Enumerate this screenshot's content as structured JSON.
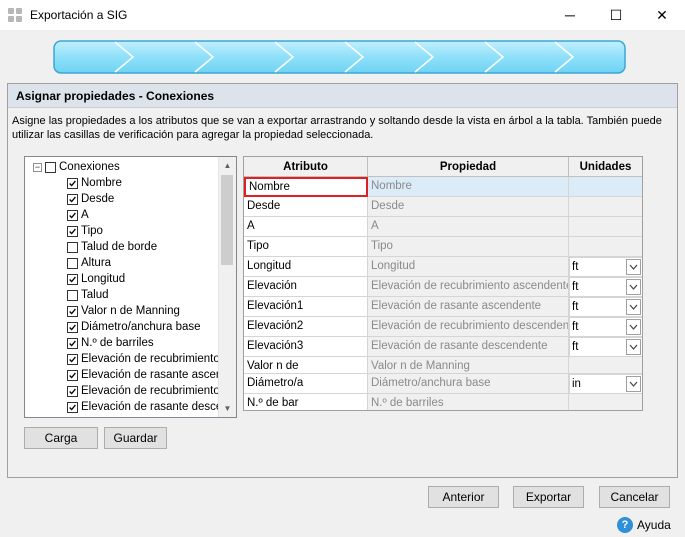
{
  "window": {
    "title": "Exportación a SIG",
    "minimize": "─",
    "maximize": "☐",
    "close": "✕"
  },
  "section": {
    "title": "Asignar propiedades - Conexiones",
    "description": "Asigne las propiedades a los atributos que se van a exportar arrastrando y soltando desde la vista en árbol a la tabla. También puede utilizar las casillas de verificación para agregar la propiedad seleccionada."
  },
  "tree": {
    "root": {
      "label": "Conexiones",
      "checked": false,
      "expander": "−"
    },
    "items": [
      {
        "label": "Nombre",
        "checked": true
      },
      {
        "label": "Desde",
        "checked": true
      },
      {
        "label": "A",
        "checked": true
      },
      {
        "label": "Tipo",
        "checked": true
      },
      {
        "label": "Talud de borde",
        "checked": false
      },
      {
        "label": "Altura",
        "checked": false
      },
      {
        "label": "Longitud",
        "checked": true
      },
      {
        "label": "Talud",
        "checked": false
      },
      {
        "label": "Valor n de Manning",
        "checked": true
      },
      {
        "label": "Diámetro/anchura base",
        "checked": true
      },
      {
        "label": "N.º de barriles",
        "checked": true
      },
      {
        "label": "Elevación de recubrimiento ascendente",
        "checked": true
      },
      {
        "label": "Elevación de rasante ascendente",
        "checked": true
      },
      {
        "label": "Elevación de recubrimiento descendente",
        "checked": true
      },
      {
        "label": "Elevación de rasante descendente",
        "checked": true
      }
    ]
  },
  "buttons": {
    "load": "Carga",
    "save": "Guardar",
    "prev": "Anterior",
    "export": "Exportar",
    "cancel": "Cancelar",
    "help": "Ayuda"
  },
  "table": {
    "headers": {
      "attribute": "Atributo",
      "property": "Propiedad",
      "units": "Unidades"
    },
    "rows": [
      {
        "attribute": "Nombre",
        "property": "Nombre",
        "units": ""
      },
      {
        "attribute": "Desde",
        "property": "Desde",
        "units": ""
      },
      {
        "attribute": "A",
        "property": "A",
        "units": ""
      },
      {
        "attribute": "Tipo",
        "property": "Tipo",
        "units": ""
      },
      {
        "attribute": "Longitud",
        "property": "Longitud",
        "units": "ft"
      },
      {
        "attribute": "Elevación",
        "property": "Elevación de recubrimiento ascendente",
        "units": "ft"
      },
      {
        "attribute": "Elevación1",
        "property": "Elevación de rasante ascendente",
        "units": "ft"
      },
      {
        "attribute": "Elevación2",
        "property": "Elevación de recubrimiento descendente",
        "units": "ft"
      },
      {
        "attribute": "Elevación3",
        "property": "Elevación de rasante descendente",
        "units": "ft"
      },
      {
        "attribute": "Valor n de",
        "property": "Valor n de Manning",
        "units": ""
      },
      {
        "attribute": "Diámetro/a",
        "property": "Diámetro/anchura base",
        "units": "in"
      },
      {
        "attribute": "N.º de bar",
        "property": "N.º de barriles",
        "units": ""
      }
    ]
  },
  "colors": {
    "progress": "#8fe0f9",
    "selection_border": "#e02020",
    "accent": "#2f8fd8"
  }
}
